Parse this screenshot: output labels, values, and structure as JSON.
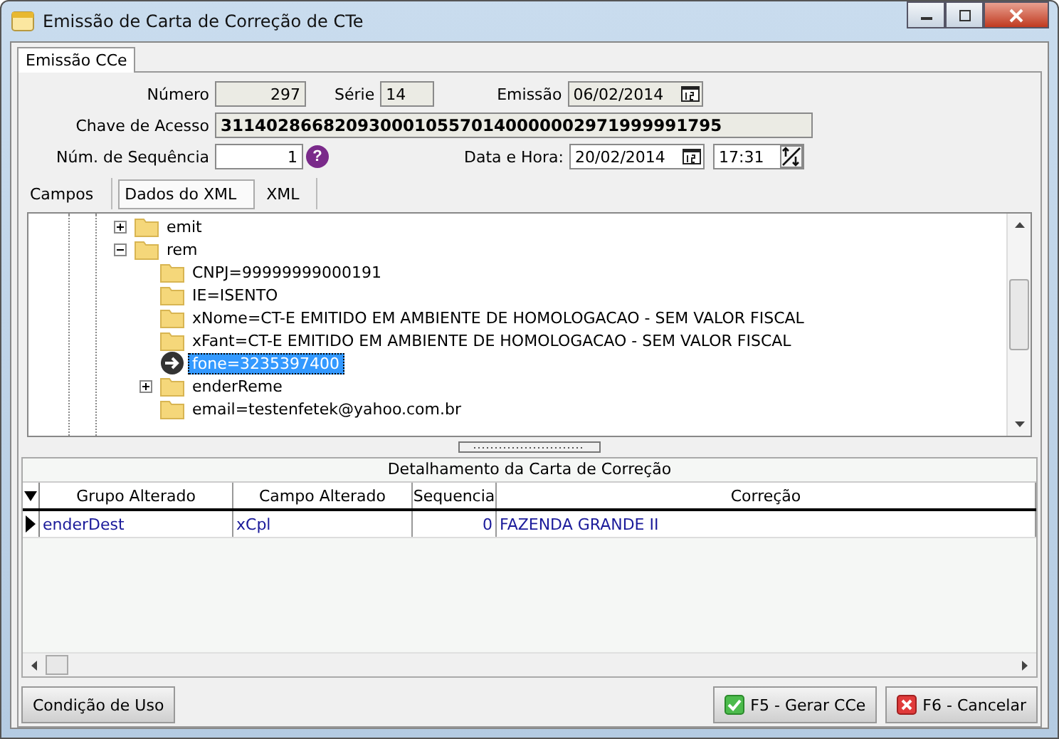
{
  "window": {
    "title": "Emissão de Carta de Correção de CTe"
  },
  "tabs": [
    {
      "label": "Emissão CCe",
      "selected": true
    }
  ],
  "form": {
    "numero": {
      "label": "Número",
      "value": "297"
    },
    "serie": {
      "label": "Série",
      "value": "14"
    },
    "emissao": {
      "label": "Emissão",
      "value": "06/02/2014"
    },
    "chave": {
      "label": "Chave de Acesso",
      "value": "31140286682093000105570140000002971999991795"
    },
    "sequencia": {
      "label": "Núm. de Sequência",
      "value": "1",
      "help": "?"
    },
    "data_hora": {
      "label": "Data e Hora:",
      "date": "20/02/2014",
      "time": "17:31"
    }
  },
  "sub_tabs": [
    {
      "label": "Campos",
      "selected": false
    },
    {
      "label": "Dados do XML",
      "selected": true
    },
    {
      "label": "XML",
      "selected": false
    }
  ],
  "tree": [
    {
      "label": "emit",
      "expanded": false,
      "selected": false
    },
    {
      "label": "rem",
      "expanded": true,
      "selected": false,
      "children": [
        {
          "label": "CNPJ=99999999000191",
          "selected": false
        },
        {
          "label": "IE=ISENTO",
          "selected": false
        },
        {
          "label": "xNome=CT-E EMITIDO EM AMBIENTE DE HOMOLOGACAO - SEM VALOR FISCAL",
          "selected": false
        },
        {
          "label": "xFant=CT-E EMITIDO EM AMBIENTE DE HOMOLOGACAO - SEM VALOR FISCAL",
          "selected": false
        },
        {
          "label": "fone=3235397400",
          "selected": true
        },
        {
          "label": "enderReme",
          "expanded": false,
          "selected": false
        },
        {
          "label": "email=testenfetek@yahoo.com.br",
          "selected": false
        }
      ]
    }
  ],
  "grid": {
    "caption": "Detalhamento da Carta de Correção",
    "columns": [
      "Grupo Alterado",
      "Campo Alterado",
      "Sequencia",
      "Correção"
    ],
    "rows": [
      {
        "selected": true,
        "cells": [
          "enderDest",
          "xCpl",
          "0",
          "FAZENDA GRANDE II"
        ]
      }
    ]
  },
  "buttons": {
    "left": "Condição de Uso",
    "generate": "F5 - Gerar CCe",
    "cancel": "F6 - Cancelar"
  }
}
